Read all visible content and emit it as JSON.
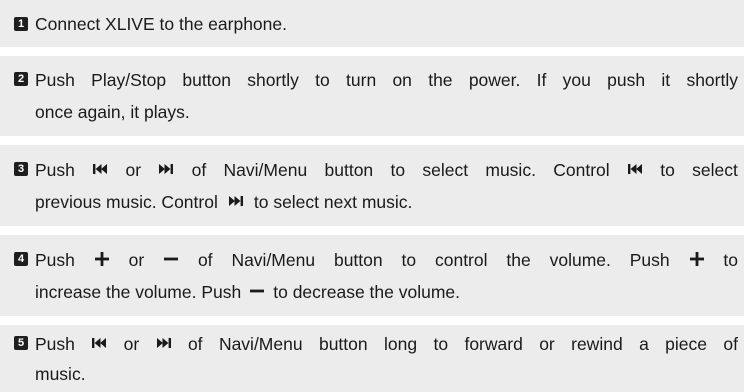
{
  "icons": {
    "prev": "skip-previous-icon",
    "next": "skip-next-icon",
    "plus": "plus-icon",
    "minus": "minus-icon"
  },
  "steps": [
    {
      "number": "1",
      "line1": "Connect XLIVE to the earphone."
    },
    {
      "number": "2",
      "line1_words": [
        "Push",
        "Play/Stop",
        "button",
        "shortly",
        "to",
        "turn",
        "on",
        "the",
        "power.",
        "If",
        "you",
        "push",
        "it",
        "shortly"
      ],
      "line2": "once again, it plays."
    },
    {
      "number": "3",
      "line1_a": "Push",
      "line1_b": "or",
      "line1_c": "of",
      "line1_d": "Navi/Menu",
      "line1_e": "button",
      "line1_f": "to",
      "line1_g": "select",
      "line1_h": "music.",
      "line1_i": "Control",
      "line1_j": "to",
      "line1_k": "select",
      "line2_a": "previous music. Control",
      "line2_b": "to select next music."
    },
    {
      "number": "4",
      "line1_a": "Push",
      "line1_b": "or",
      "line1_c": "of",
      "line1_d": "Navi/Menu",
      "line1_e": "button",
      "line1_f": "to",
      "line1_g": "control",
      "line1_h": "the",
      "line1_i": "volume.",
      "line1_j": "Push",
      "line1_k": "to",
      "line2_a": "increase the volume. Push",
      "line2_b": "to decrease the volume."
    },
    {
      "number": "5",
      "line1_a": "Push",
      "line1_b": "or",
      "line1_c": "of",
      "line1_d": "Navi/Menu",
      "line1_e": "button",
      "line1_f": "long",
      "line1_g": "to",
      "line1_h": "forward",
      "line1_i": "or",
      "line1_j": "rewind",
      "line1_k": "a",
      "line1_l": "piece",
      "line1_m": "of",
      "line2": "music."
    }
  ]
}
